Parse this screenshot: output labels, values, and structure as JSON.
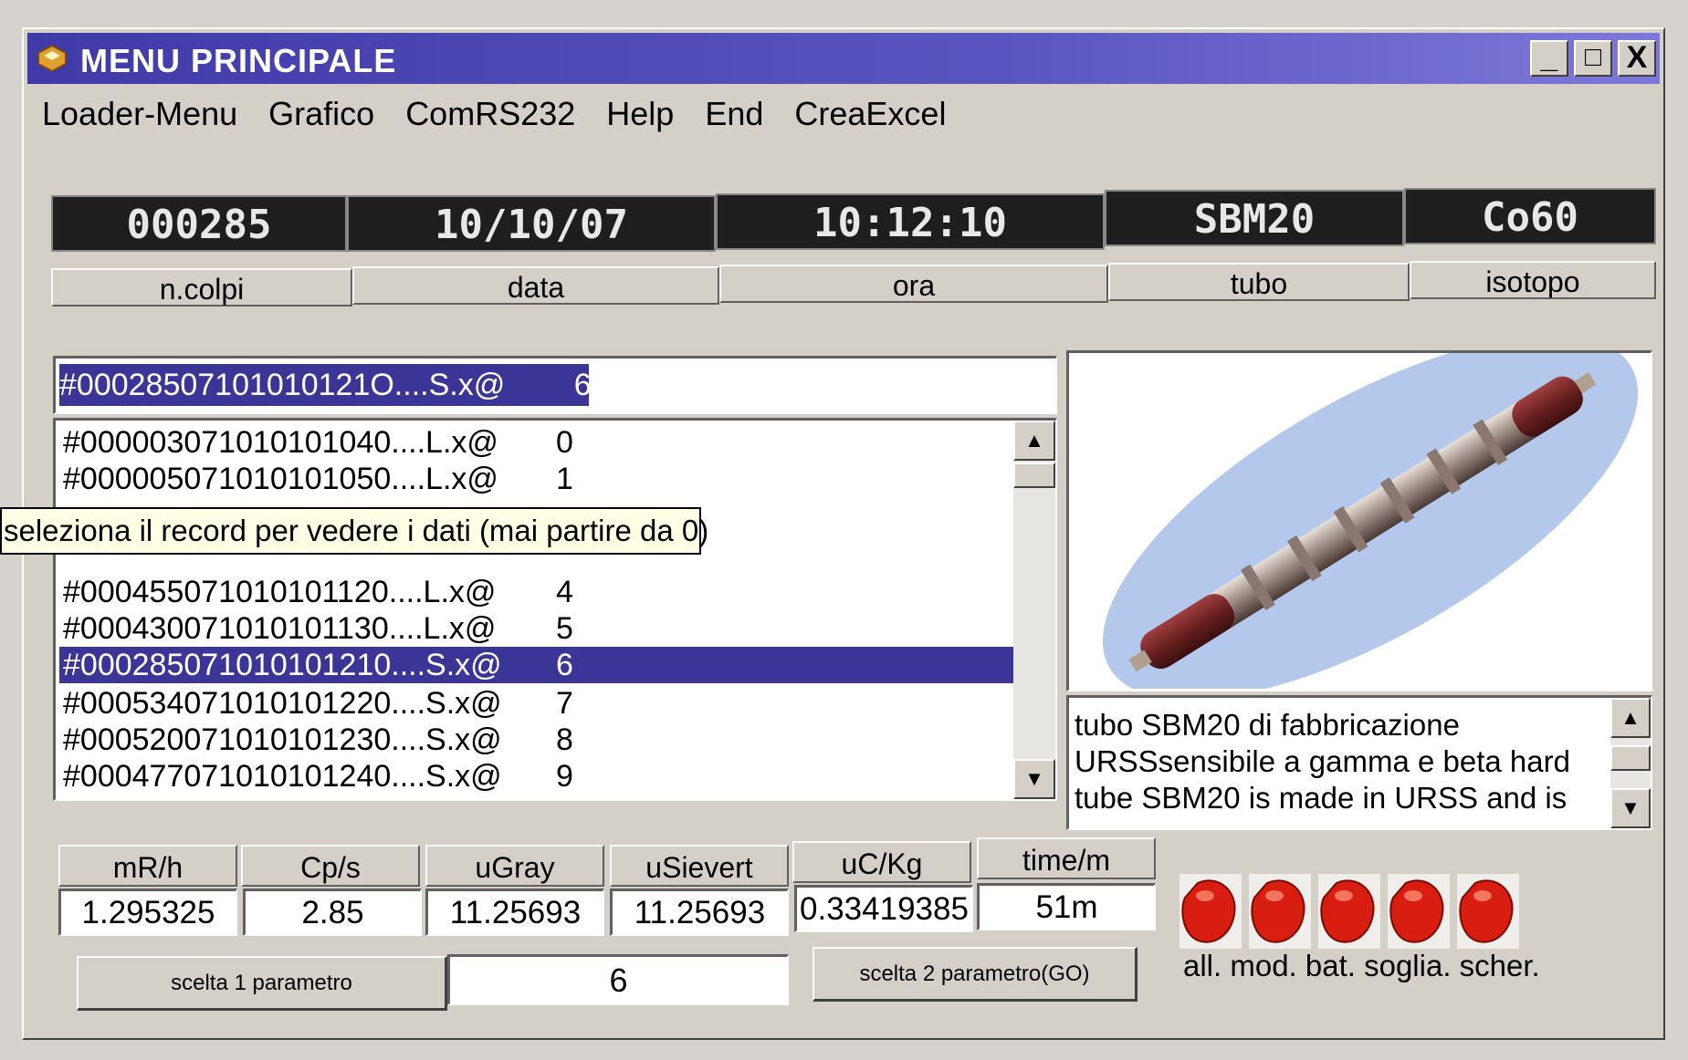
{
  "window": {
    "title": "MENU PRINCIPALE",
    "buttons": [
      "_",
      "□",
      "X"
    ]
  },
  "menu": [
    "Loader-Menu",
    "Grafico",
    "ComRS232",
    "Help",
    "End",
    "CreaExcel"
  ],
  "header": {
    "values": [
      "000285",
      "10/10/07",
      "10:12:10",
      "SBM20",
      "Co60"
    ],
    "labels": [
      "n.colpi",
      "data",
      "ora",
      "tubo",
      "isotopo"
    ]
  },
  "selected_record": "#00028507101010121O....S.x@        6",
  "records": [
    {
      "code": "#000003071010101040....L.x@",
      "idx": "0"
    },
    {
      "code": "#000005071010101050....L.x@",
      "idx": "1"
    },
    {
      "code": "#000455071010101120....L.x@",
      "idx": "4"
    },
    {
      "code": "#000430071010101130....L.x@",
      "idx": "5"
    },
    {
      "code": "#000285071010101210....S.x@",
      "idx": "6"
    },
    {
      "code": "#000534071010101220....S.x@",
      "idx": "7"
    },
    {
      "code": "#000520071010101230....S.x@",
      "idx": "8"
    },
    {
      "code": "#000477071010101240....S.x@",
      "idx": "9"
    }
  ],
  "tooltip": "seleziona il record per vedere i dati (mai partire da 0)",
  "description": [
    "tubo SBM20 di fabbricazione",
    "URSSsensibile a gamma e beta hard",
    "tube SBM20 is made in URSS and is"
  ],
  "params": {
    "labels": [
      "mR/h",
      "Cp/s",
      "uGray",
      "uSievert",
      "uC/Kg",
      "time/m"
    ],
    "values": [
      "1.295325",
      "2.85",
      "11.25693",
      "11.25693",
      "0.33419385",
      "51m"
    ]
  },
  "controls": {
    "btn1": "scelta 1 parametro",
    "field": "6",
    "btn2": "scelta 2 parametro(GO)"
  },
  "indicators": {
    "labels": "all. mod. bat. soglia. scher.",
    "color": "#d81e10"
  }
}
